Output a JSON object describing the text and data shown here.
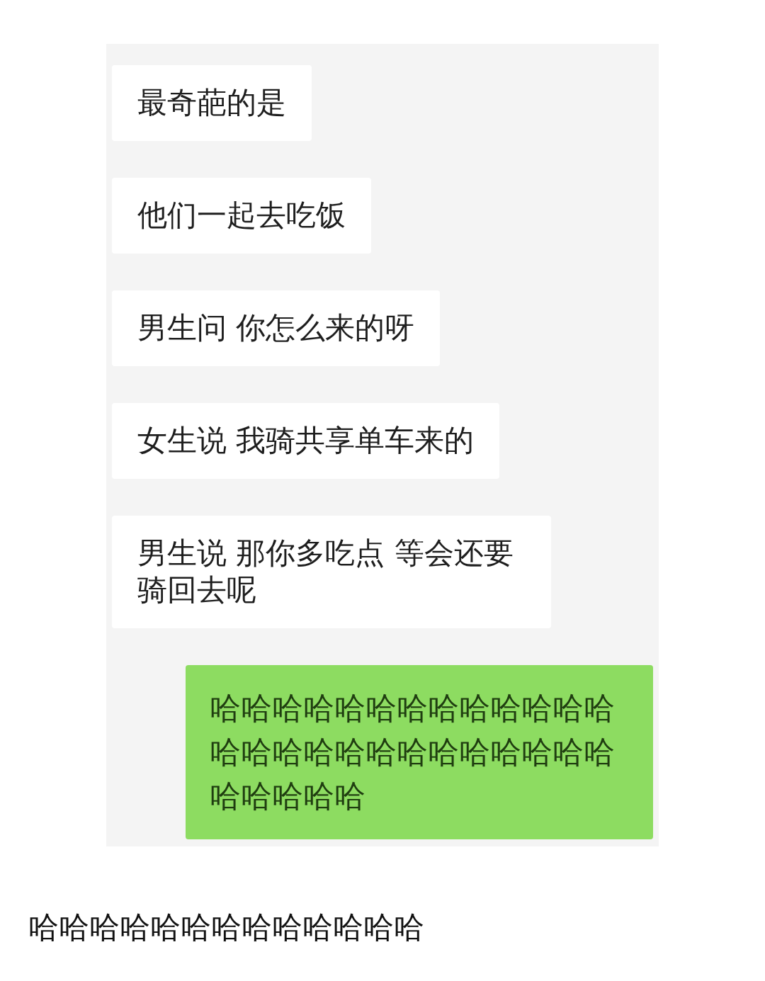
{
  "messages": [
    {
      "kind": "received",
      "text": "最奇葩的是"
    },
    {
      "kind": "received",
      "text": "他们一起去吃饭"
    },
    {
      "kind": "received",
      "text": "男生问 你怎么来的呀"
    },
    {
      "kind": "received",
      "text": "女生说 我骑共享单车来的"
    },
    {
      "kind": "received",
      "text": "男生说 那你多吃点 等会还要骑回去呢"
    },
    {
      "kind": "sent",
      "text": "哈哈哈哈哈哈哈哈哈哈哈哈哈哈哈哈哈哈哈哈哈哈哈哈哈哈哈哈哈哈哈"
    }
  ],
  "caption": "哈哈哈哈哈哈哈哈哈哈哈哈哈"
}
